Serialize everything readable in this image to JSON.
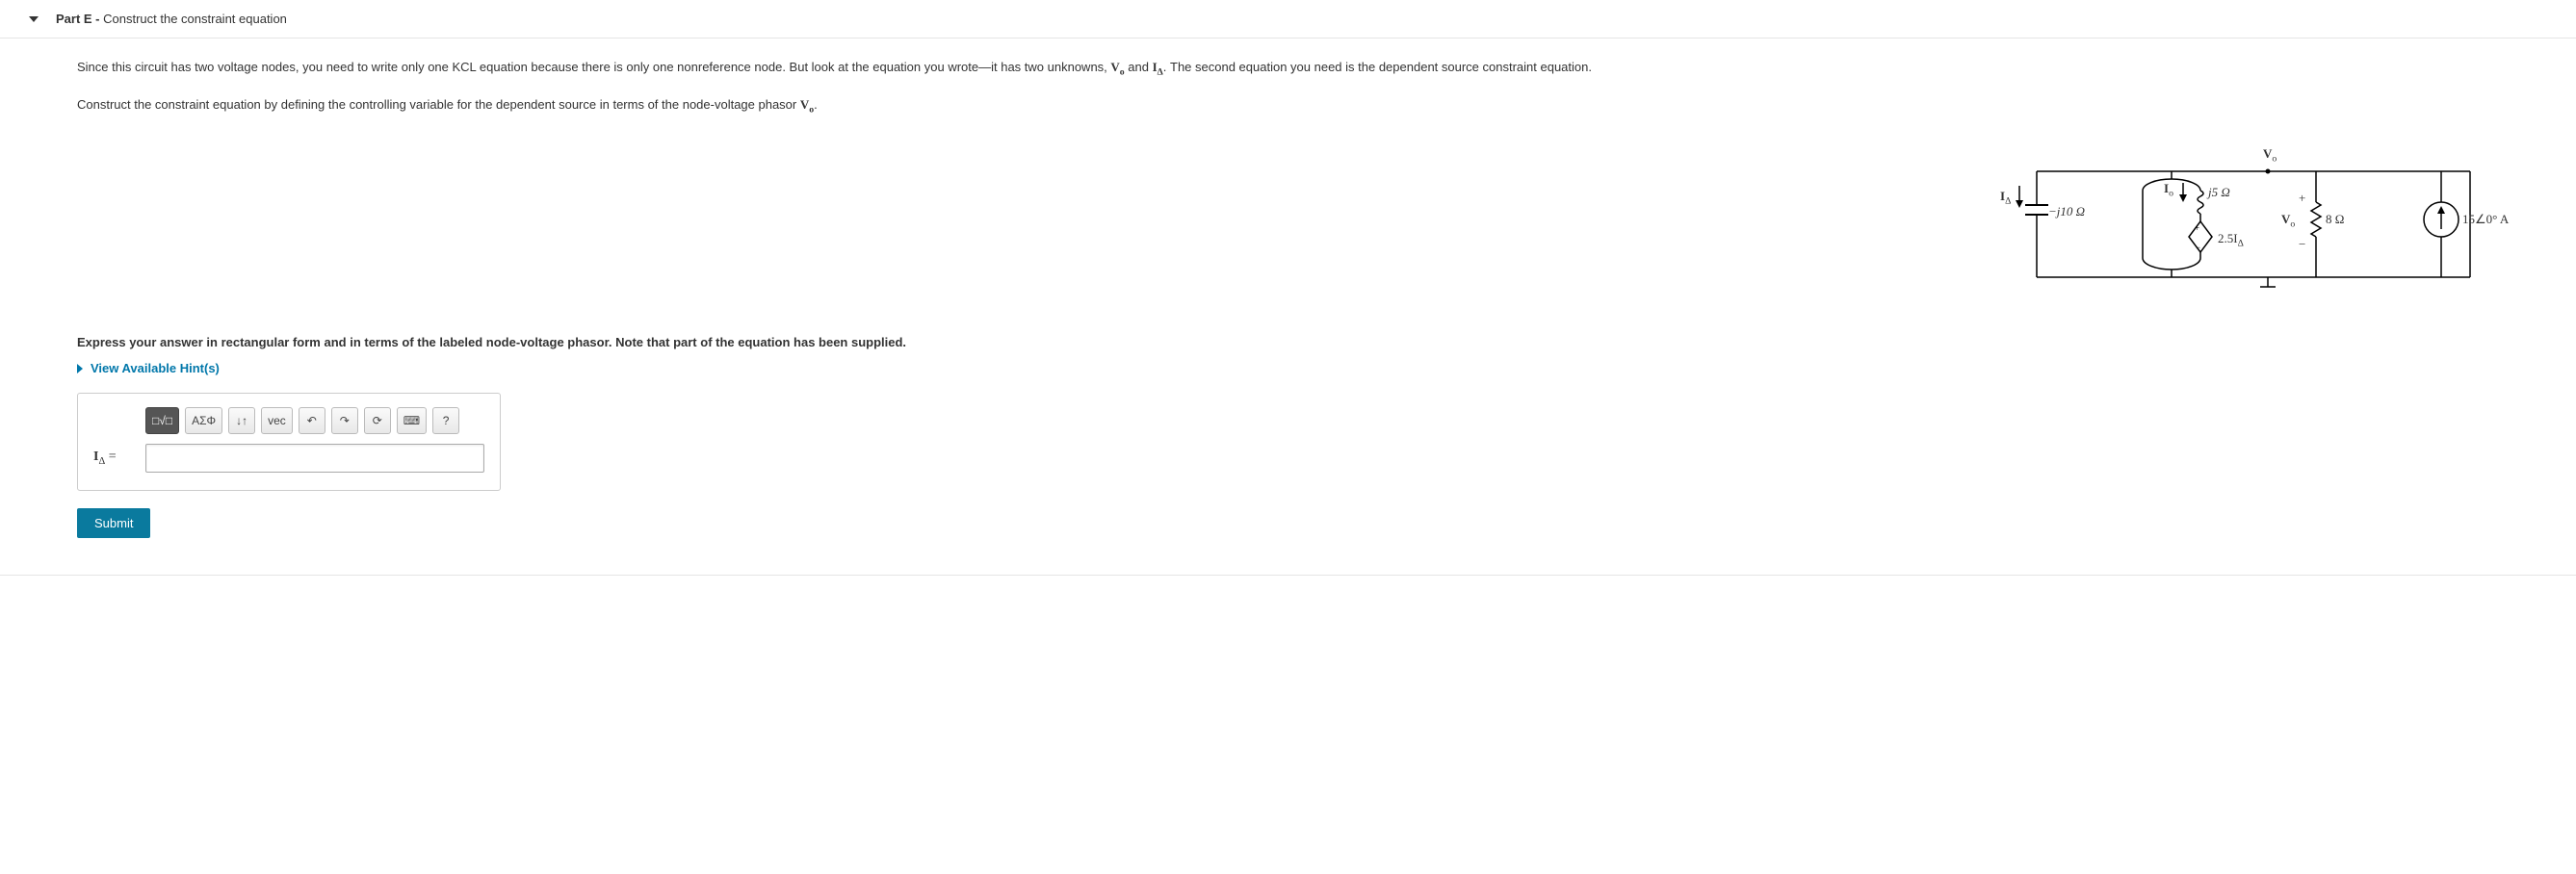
{
  "header": {
    "part_label": "Part E - ",
    "part_title": "Construct the constraint equation"
  },
  "body": {
    "paragraph1_a": "Since this circuit has two voltage nodes, you need to write only one KCL equation because there is only one nonreference node.  But look at the equation you wrote—it has two unknowns, ",
    "var_Vo": "V",
    "var_Vo_sub": "o",
    "paragraph1_b": " and ",
    "var_Idelta": "I",
    "var_Idelta_sub": "Δ",
    "paragraph1_c": ". The second equation you need is the dependent source constraint equation.",
    "paragraph2_a": "Construct the constraint equation by defining the controlling variable for the dependent source in terms of the node-voltage phasor ",
    "paragraph2_b": "."
  },
  "diagram": {
    "Vo_top": "V",
    "Vo_top_sub": "o",
    "Io": "I",
    "Io_sub": "o",
    "j5": "j5 Ω",
    "Idelta": "I",
    "Idelta_sub": "Δ",
    "neg_j10": "−j10 Ω",
    "dep_src": "2.5I",
    "dep_src_sub": "Δ",
    "plus": "+",
    "minus": "−",
    "Vo_right": "V",
    "Vo_right_sub": "o",
    "r8": "8 Ω",
    "current_src": "15∠0°  A"
  },
  "express": "Express your answer in rectangular form and in terms of the labeled node-voltage phasor. Note that part of the equation has been supplied.",
  "hints": "View Available Hint(s)",
  "toolbar": {
    "templates": "□√□",
    "greek": "ΑΣΦ",
    "scripts": "↓↑",
    "vec": "vec",
    "undo": "↶",
    "redo": "↷",
    "reset": "⟳",
    "keyboard": "⌨",
    "help": "?"
  },
  "answer": {
    "lhs_a": "I",
    "lhs_sub": "Δ",
    "lhs_b": " = ",
    "value": ""
  },
  "submit": "Submit"
}
